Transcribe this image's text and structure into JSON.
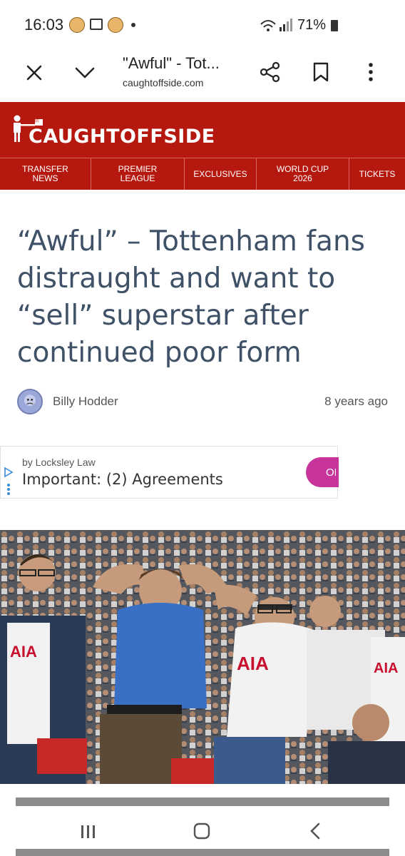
{
  "status_bar": {
    "time": "16:03",
    "battery": "71%"
  },
  "browser": {
    "title": "\"Awful\" - Tot...",
    "url": "caughtoffside.com"
  },
  "site": {
    "logo": "CAUGHTOFFSIDE",
    "nav": [
      {
        "line1": "TRANSFER",
        "line2": "NEWS"
      },
      {
        "line1": "PREMIER",
        "line2": "LEAGUE"
      },
      {
        "line1": "EXCLUSIVES",
        "line2": ""
      },
      {
        "line1": "WORLD CUP",
        "line2": "2026"
      },
      {
        "line1": "TICKETS",
        "line2": ""
      }
    ]
  },
  "article": {
    "headline": "“Awful” – Tottenham fans distraught and want to “sell” superstar after continued poor form",
    "author": "Billy Hodder",
    "date": "8 years ago"
  },
  "ad": {
    "by": "by Locksley Law",
    "title": "Important: (2) Agreements",
    "button": "OP"
  },
  "photo": {
    "shirt_text": "AIA"
  },
  "colors": {
    "brand_red": "#b5180f",
    "headline": "#3f5166",
    "ad_button": "#c8359a"
  }
}
